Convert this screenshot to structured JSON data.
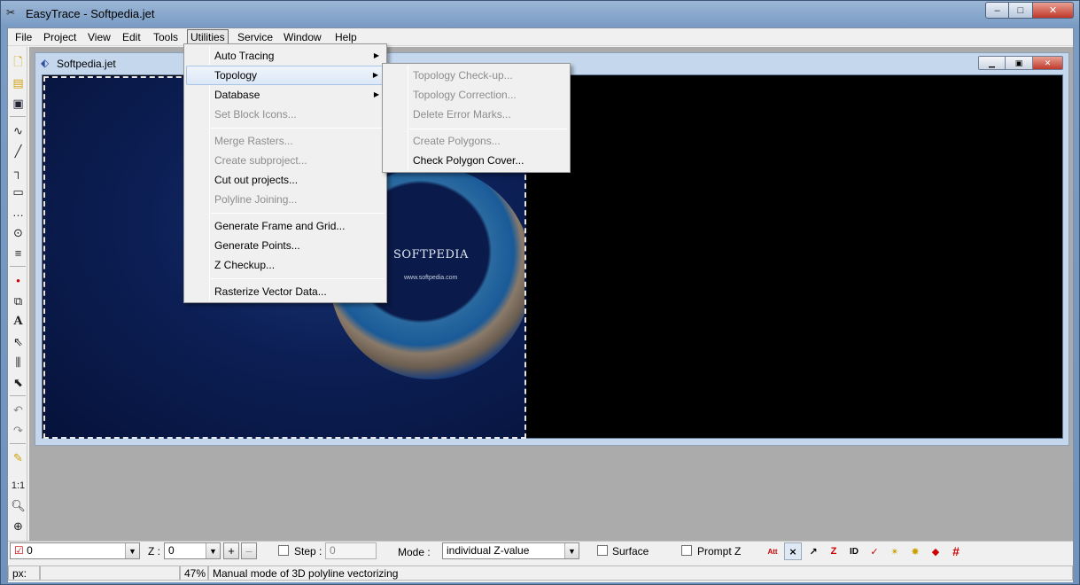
{
  "window": {
    "title": "EasyTrace - Softpedia.jet",
    "min": "–",
    "max": "□",
    "close": "✕"
  },
  "menubar": {
    "items": [
      "File",
      "Project",
      "View",
      "Edit",
      "Tools",
      "Utilities",
      "Service",
      "Window",
      "Help"
    ],
    "active": "Utilities"
  },
  "utilities_menu": {
    "items": [
      {
        "label": "Auto Tracing",
        "submenu": true,
        "enabled": true
      },
      {
        "label": "Topology",
        "submenu": true,
        "enabled": true,
        "highlighted": true
      },
      {
        "label": "Database",
        "submenu": true,
        "enabled": true
      },
      {
        "label": "Set Block Icons...",
        "enabled": false
      },
      {
        "label": "Merge Rasters...",
        "enabled": false
      },
      {
        "label": "Create subproject...",
        "enabled": false
      },
      {
        "label": "Cut out projects...",
        "enabled": true
      },
      {
        "label": "Polyline Joining...",
        "enabled": false
      },
      {
        "label": "Generate Frame and Grid...",
        "enabled": true
      },
      {
        "label": "Generate Points...",
        "enabled": true
      },
      {
        "label": "Z Checkup...",
        "enabled": true
      },
      {
        "label": "Rasterize Vector Data...",
        "enabled": true
      }
    ]
  },
  "topology_submenu": {
    "items": [
      {
        "label": "Topology Check-up...",
        "enabled": false
      },
      {
        "label": "Topology Correction...",
        "enabled": false
      },
      {
        "label": "Delete Error Marks...",
        "enabled": false
      },
      {
        "label": "Create Polygons...",
        "enabled": false
      },
      {
        "label": "Check Polygon Cover...",
        "enabled": true
      }
    ]
  },
  "document": {
    "name": "Softpedia.jet",
    "watermark": "SOFTPEDIA",
    "watermark_url": "www.softpedia.com"
  },
  "bottom": {
    "layer_value": "0",
    "z_label": "Z :",
    "z_value": "0",
    "plus": "+",
    "minus": "–",
    "step_label": "Step :",
    "step_value": "0",
    "mode_label": "Mode :",
    "mode_value": "individual Z-value",
    "surface_label": "Surface",
    "prompt_z_label": "Prompt Z"
  },
  "status": {
    "px_label": "px:",
    "zoom": "47%",
    "message": "Manual mode of 3D polyline vectorizing"
  }
}
